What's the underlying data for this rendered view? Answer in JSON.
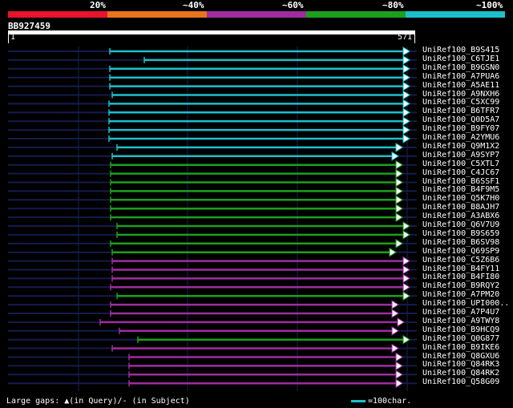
{
  "legend": {
    "colors": [
      "#e8142c",
      "#e8741c",
      "#a02ca0",
      "#1ca01c",
      "#1cc0cc"
    ],
    "labels": [
      "20%",
      "~40%",
      "~60%",
      "~80%",
      "~100%"
    ]
  },
  "query": {
    "id": "BB927459",
    "start": "1",
    "end": "571"
  },
  "hits": [
    {
      "name": "UniRef100_B9S415",
      "color": "#1cc0cc"
    },
    {
      "name": "UniRef100_C6TJE1",
      "color": "#1cc0cc"
    },
    {
      "name": "UniRef100_B9GSN0",
      "color": "#1cc0cc"
    },
    {
      "name": "UniRef100_A7PUA6",
      "color": "#1cc0cc"
    },
    {
      "name": "UniRef100_A5AE11",
      "color": "#1cc0cc"
    },
    {
      "name": "UniRef100_A9NXH6",
      "color": "#1cc0cc"
    },
    {
      "name": "UniRef100_C5XC99",
      "color": "#1cc0cc"
    },
    {
      "name": "UniRef100_B6TFR7",
      "color": "#1cc0cc"
    },
    {
      "name": "UniRef100_Q0D5A7",
      "color": "#1cc0cc"
    },
    {
      "name": "UniRef100_B9FY07",
      "color": "#1cc0cc"
    },
    {
      "name": "UniRef100_A2YMU6",
      "color": "#1cc0cc"
    },
    {
      "name": "UniRef100_Q9M1X2",
      "color": "#1cc0cc"
    },
    {
      "name": "UniRef100_A9SYP7",
      "color": "#1cc0cc"
    },
    {
      "name": "UniRef100_C5XTL7",
      "color": "#1ca01c"
    },
    {
      "name": "UniRef100_C4JC67",
      "color": "#1ca01c"
    },
    {
      "name": "UniRef100_B6SSF1",
      "color": "#1ca01c"
    },
    {
      "name": "UniRef100_B4F9M5",
      "color": "#1ca01c"
    },
    {
      "name": "UniRef100_Q5K7H0",
      "color": "#1ca01c"
    },
    {
      "name": "UniRef100_B8AJH7",
      "color": "#1ca01c"
    },
    {
      "name": "UniRef100_A3ABX6",
      "color": "#1ca01c"
    },
    {
      "name": "UniRef100_Q6V7U9",
      "color": "#1ca01c"
    },
    {
      "name": "UniRef100_B9S659",
      "color": "#1ca01c"
    },
    {
      "name": "UniRef100_B6SV98",
      "color": "#1ca01c"
    },
    {
      "name": "UniRef100_Q69SP9",
      "color": "#1ca01c"
    },
    {
      "name": "UniRef100_C5Z6B6",
      "color": "#a02ca0"
    },
    {
      "name": "UniRef100_B4FY11",
      "color": "#a02ca0"
    },
    {
      "name": "UniRef100_B4FI80",
      "color": "#a02ca0"
    },
    {
      "name": "UniRef100_B9RQY2",
      "color": "#a02ca0"
    },
    {
      "name": "UniRef100_A7PM20",
      "color": "#1ca01c"
    },
    {
      "name": "UniRef100_UPI000..",
      "color": "#a02ca0"
    },
    {
      "name": "UniRef100_A7P4U7",
      "color": "#a02ca0"
    },
    {
      "name": "UniRef100_A9TWY8",
      "color": "#a02ca0"
    },
    {
      "name": "UniRef100_B9HCQ9",
      "color": "#a02ca0"
    },
    {
      "name": "UniRef100_Q0G877",
      "color": "#1ca01c"
    },
    {
      "name": "UniRef100_B9IKE6",
      "color": "#a02ca0"
    },
    {
      "name": "UniRef100_Q8GXU6",
      "color": "#a02ca0"
    },
    {
      "name": "UniRef100_Q84RK3",
      "color": "#a02ca0"
    },
    {
      "name": "UniRef100_Q84RK2",
      "color": "#a02ca0"
    },
    {
      "name": "UniRef100_Q58G09",
      "color": "#a02ca0"
    }
  ],
  "footer": {
    "gaps_text": "Large gaps: ▲(in Query)/- (in Subject)",
    "scale_color": "#1cc0cc",
    "scale_text": "=100char."
  }
}
